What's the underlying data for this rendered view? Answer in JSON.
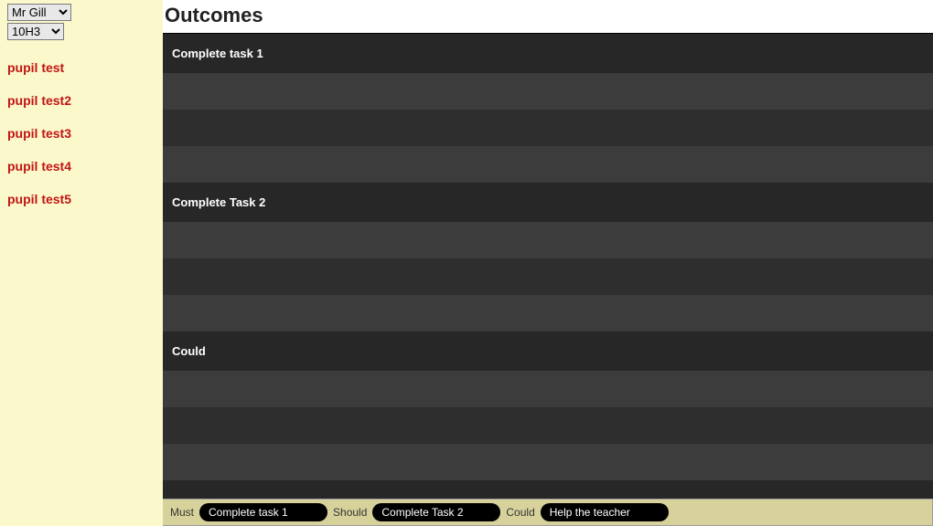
{
  "sidebar": {
    "teacher_selected": "Mr Gill",
    "class_selected": "10H3",
    "pupils": [
      "pupil test",
      "pupil test2",
      "pupil test3",
      "pupil test4",
      "pupil test5"
    ]
  },
  "main": {
    "heading": "Outcomes",
    "sections": [
      "Complete task 1",
      "Complete Task 2",
      "Could"
    ]
  },
  "footer": {
    "must_label": "Must",
    "must_value": "Complete task 1",
    "should_label": "Should",
    "should_value": "Complete Task 2",
    "could_label": "Could",
    "could_value": "Help the teacher"
  }
}
